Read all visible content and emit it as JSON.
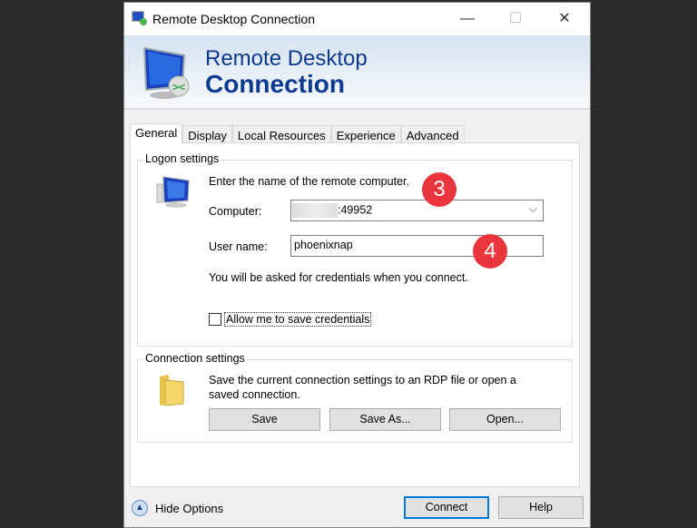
{
  "window": {
    "title": "Remote Desktop Connection"
  },
  "banner": {
    "line1": "Remote Desktop",
    "line2": "Connection"
  },
  "tabs": [
    {
      "label": "General",
      "active": true
    },
    {
      "label": "Display"
    },
    {
      "label": "Local Resources"
    },
    {
      "label": "Experience"
    },
    {
      "label": "Advanced"
    }
  ],
  "logon": {
    "title": "Logon settings",
    "prompt": "Enter the name of the remote computer.",
    "computer_label": "Computer:",
    "computer_value": ":49952",
    "username_label": "User name:",
    "username_value": "phoenixnap",
    "note": "You will be asked for credentials when you connect.",
    "save_creds_label": "Allow me to save credentials",
    "save_creds_checked": false
  },
  "connection": {
    "title": "Connection settings",
    "text": "Save the current connection settings to an RDP file or open a saved connection.",
    "save": "Save",
    "save_as": "Save As...",
    "open": "Open..."
  },
  "footer": {
    "hide_options": "Hide Options",
    "connect": "Connect",
    "help": "Help"
  },
  "annotations": [
    "3",
    "4"
  ],
  "colors": {
    "badge": "#e8363c",
    "banner_text": "#0b3a91"
  }
}
